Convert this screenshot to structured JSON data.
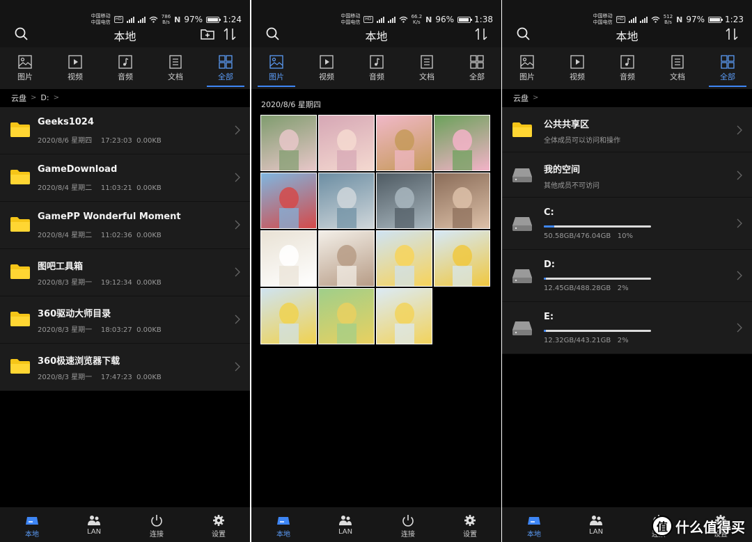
{
  "status_bars": [
    {
      "carrier1": "中国移动",
      "carrier2": "中国电信",
      "speed": "786\nB/s",
      "battery": "97%",
      "time": "1:24",
      "battery_level": 0.97
    },
    {
      "carrier1": "中国移动",
      "carrier2": "中国电信",
      "speed": "66.2\nK/s",
      "battery": "96%",
      "time": "1:38",
      "battery_level": 0.96
    },
    {
      "carrier1": "中国移动",
      "carrier2": "中国电信",
      "speed": "512\nB/s",
      "battery": "97%",
      "time": "1:23",
      "battery_level": 0.97
    }
  ],
  "hd_badge": "HD",
  "nfc_symbol": "N",
  "header": {
    "title": "本地"
  },
  "tabs": [
    {
      "label": "图片",
      "icon": "image-icon"
    },
    {
      "label": "视频",
      "icon": "video-icon"
    },
    {
      "label": "音频",
      "icon": "audio-icon"
    },
    {
      "label": "文档",
      "icon": "document-icon"
    },
    {
      "label": "全部",
      "icon": "grid-icon"
    }
  ],
  "screen1": {
    "breadcrumb": [
      "云盘",
      "D:"
    ],
    "active_tab": 4,
    "folders": [
      {
        "name": "Geeks1024",
        "date": "2020/8/6",
        "weekday": "星期四",
        "time": "17:23:03",
        "size": "0.00KB"
      },
      {
        "name": "GameDownload",
        "date": "2020/8/4",
        "weekday": "星期二",
        "time": "11:03:21",
        "size": "0.00KB"
      },
      {
        "name": "GamePP Wonderful Moment",
        "date": "2020/8/4",
        "weekday": "星期二",
        "time": "11:02:36",
        "size": "0.00KB"
      },
      {
        "name": "图吧工具箱",
        "date": "2020/8/3",
        "weekday": "星期一",
        "time": "19:12:34",
        "size": "0.00KB"
      },
      {
        "name": "360驱动大师目录",
        "date": "2020/8/3",
        "weekday": "星期一",
        "time": "18:03:27",
        "size": "0.00KB"
      },
      {
        "name": "360极速浏览器下载",
        "date": "2020/8/3",
        "weekday": "星期一",
        "time": "17:47:23",
        "size": "0.00KB"
      }
    ]
  },
  "screen2": {
    "active_tab": 0,
    "date_header": "2020/8/6 星期四",
    "photo_count": 15
  },
  "screen3": {
    "breadcrumb": [
      "云盘"
    ],
    "active_tab": 4,
    "items": [
      {
        "name": "公共共享区",
        "subtitle": "全体成员可以访问和操作",
        "kind": "folder"
      },
      {
        "name": "我的空间",
        "subtitle": "其他成员不可访问",
        "kind": "drive"
      },
      {
        "name": "C:",
        "used": "50.58GB/476.04GB",
        "percent": "10%",
        "usage": 0.1,
        "kind": "drive"
      },
      {
        "name": "D:",
        "used": "12.45GB/488.28GB",
        "percent": "2%",
        "usage": 0.02,
        "kind": "drive"
      },
      {
        "name": "E:",
        "used": "12.32GB/443.21GB",
        "percent": "2%",
        "usage": 0.02,
        "kind": "drive"
      }
    ]
  },
  "bottom_nav": [
    {
      "label": "本地",
      "icon": "local-storage-icon"
    },
    {
      "label": "LAN",
      "icon": "users-icon"
    },
    {
      "label": "连接",
      "icon": "power-icon"
    },
    {
      "label": "设置",
      "icon": "settings-gear-icon"
    }
  ],
  "watermark": {
    "logo": "值",
    "text": "什么值得买"
  },
  "colors": {
    "accent": "#3e86f5",
    "folder": "#f5c518",
    "background": "#000000",
    "row": "#1c1c1c"
  }
}
